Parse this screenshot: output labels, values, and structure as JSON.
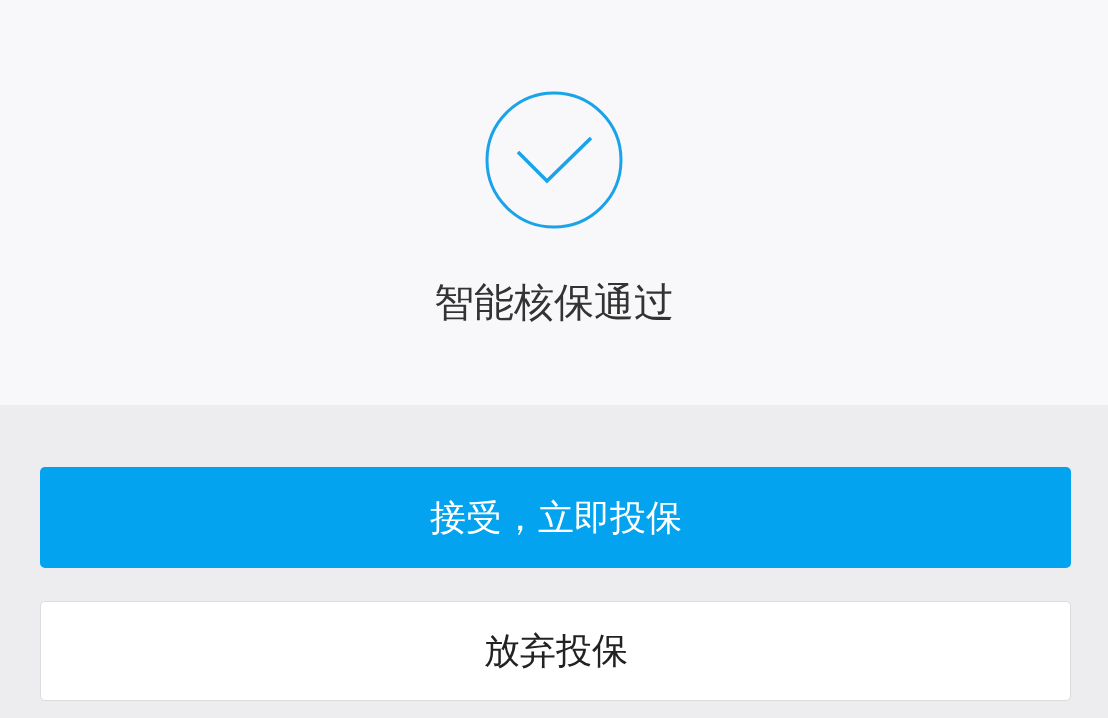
{
  "result": {
    "title": "智能核保通过"
  },
  "buttons": [
    {
      "label": "接受，立即投保",
      "kind": "primary"
    },
    {
      "label": "放弃投保",
      "kind": "secondary"
    }
  ]
}
